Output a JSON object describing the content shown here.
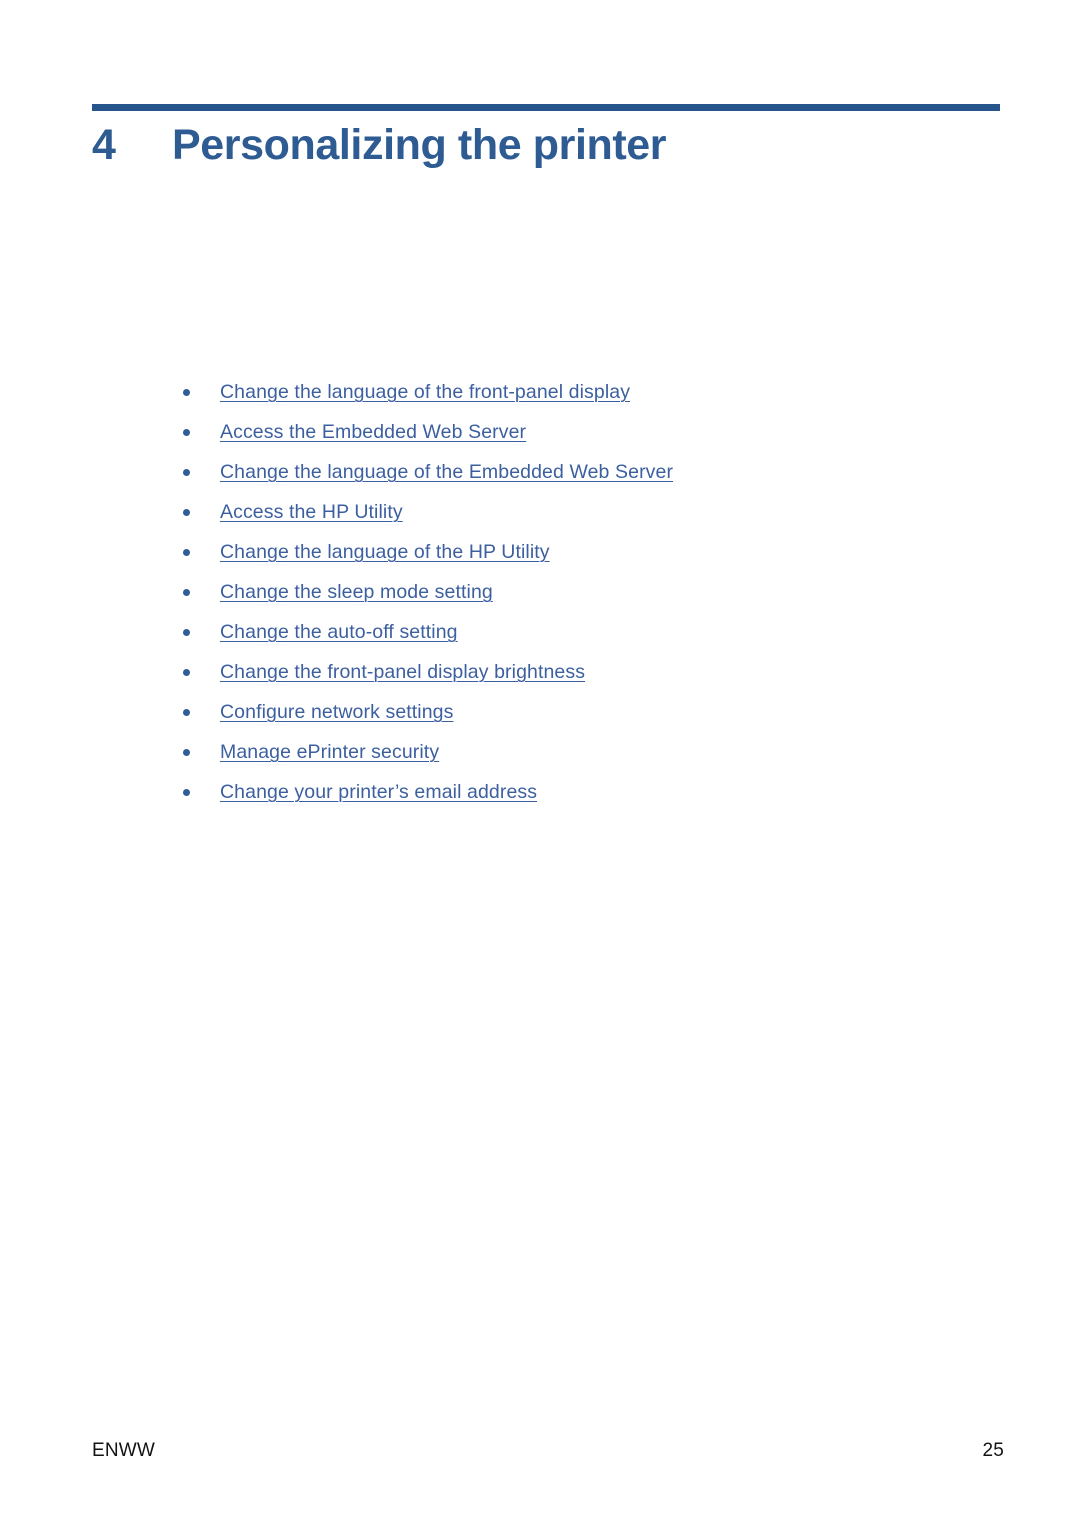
{
  "page": {
    "background_color": "#ffffff",
    "accent_color": "#27548a",
    "title_color": "#2d5b92",
    "link_color": "#3c5fa0"
  },
  "chapter": {
    "number": "4",
    "title": "Personalizing the printer"
  },
  "toc": {
    "items": [
      {
        "label": "Change the language of the front-panel display"
      },
      {
        "label": "Access the Embedded Web Server"
      },
      {
        "label": "Change the language of the Embedded Web Server"
      },
      {
        "label": "Access the HP Utility"
      },
      {
        "label": "Change the language of the HP Utility"
      },
      {
        "label": "Change the sleep mode setting"
      },
      {
        "label": "Change the auto-off setting"
      },
      {
        "label": "Change the front-panel display brightness"
      },
      {
        "label": "Configure network settings"
      },
      {
        "label": "Manage ePrinter security"
      },
      {
        "label": "Change your printer’s email address"
      }
    ]
  },
  "footer": {
    "left": "ENWW",
    "page_number": "25"
  }
}
